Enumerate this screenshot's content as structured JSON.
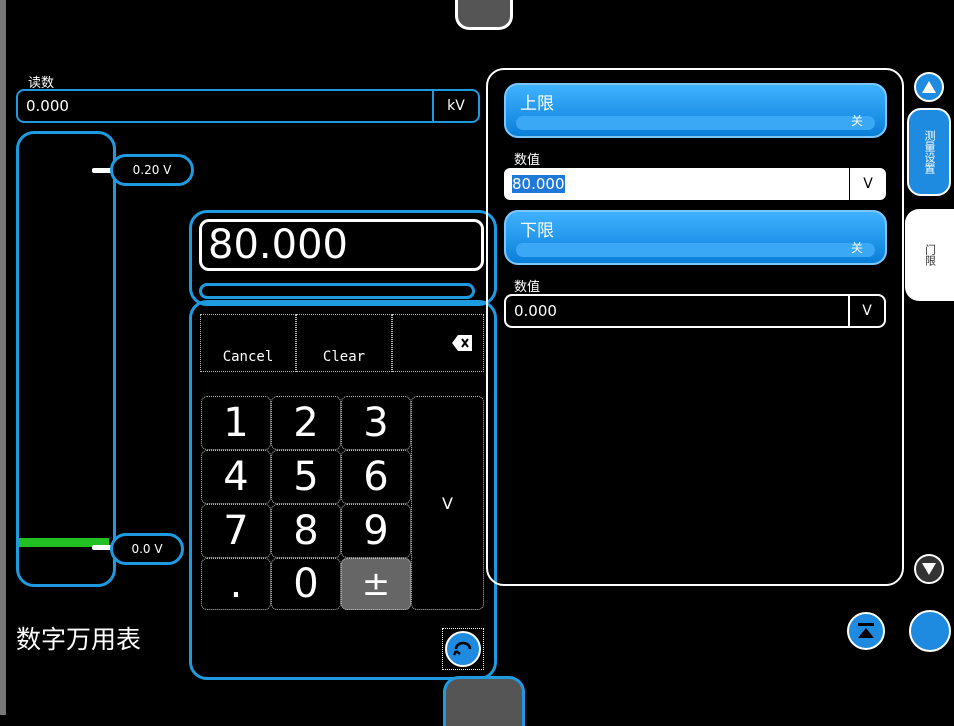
{
  "reading": {
    "label": "读数",
    "value": "0.000",
    "unit": "kV"
  },
  "slider": {
    "upper_value": "0.20 V",
    "lower_value": "0.0 V"
  },
  "display": {
    "value": "80.000"
  },
  "keypad": {
    "cancel": "Cancel",
    "clear": "Clear",
    "backspace_icon": "backspace-icon",
    "keys": [
      "1",
      "2",
      "3",
      "4",
      "5",
      "6",
      "7",
      "8",
      "9",
      ".",
      "0",
      "±"
    ],
    "unit": "V"
  },
  "app_title": "数字万用表",
  "limits": {
    "upper": {
      "title": "上限",
      "state": "关",
      "value_label": "数值",
      "value": "80.000",
      "unit": "V"
    },
    "lower": {
      "title": "下限",
      "state": "关",
      "value_label": "数值",
      "value": "0.000",
      "unit": "V"
    }
  },
  "side_tabs": {
    "measure": "测量设置",
    "threshold": "门限"
  },
  "colors": {
    "accent": "#1e9be0",
    "green_level": "#22c022",
    "background": "#000000"
  }
}
